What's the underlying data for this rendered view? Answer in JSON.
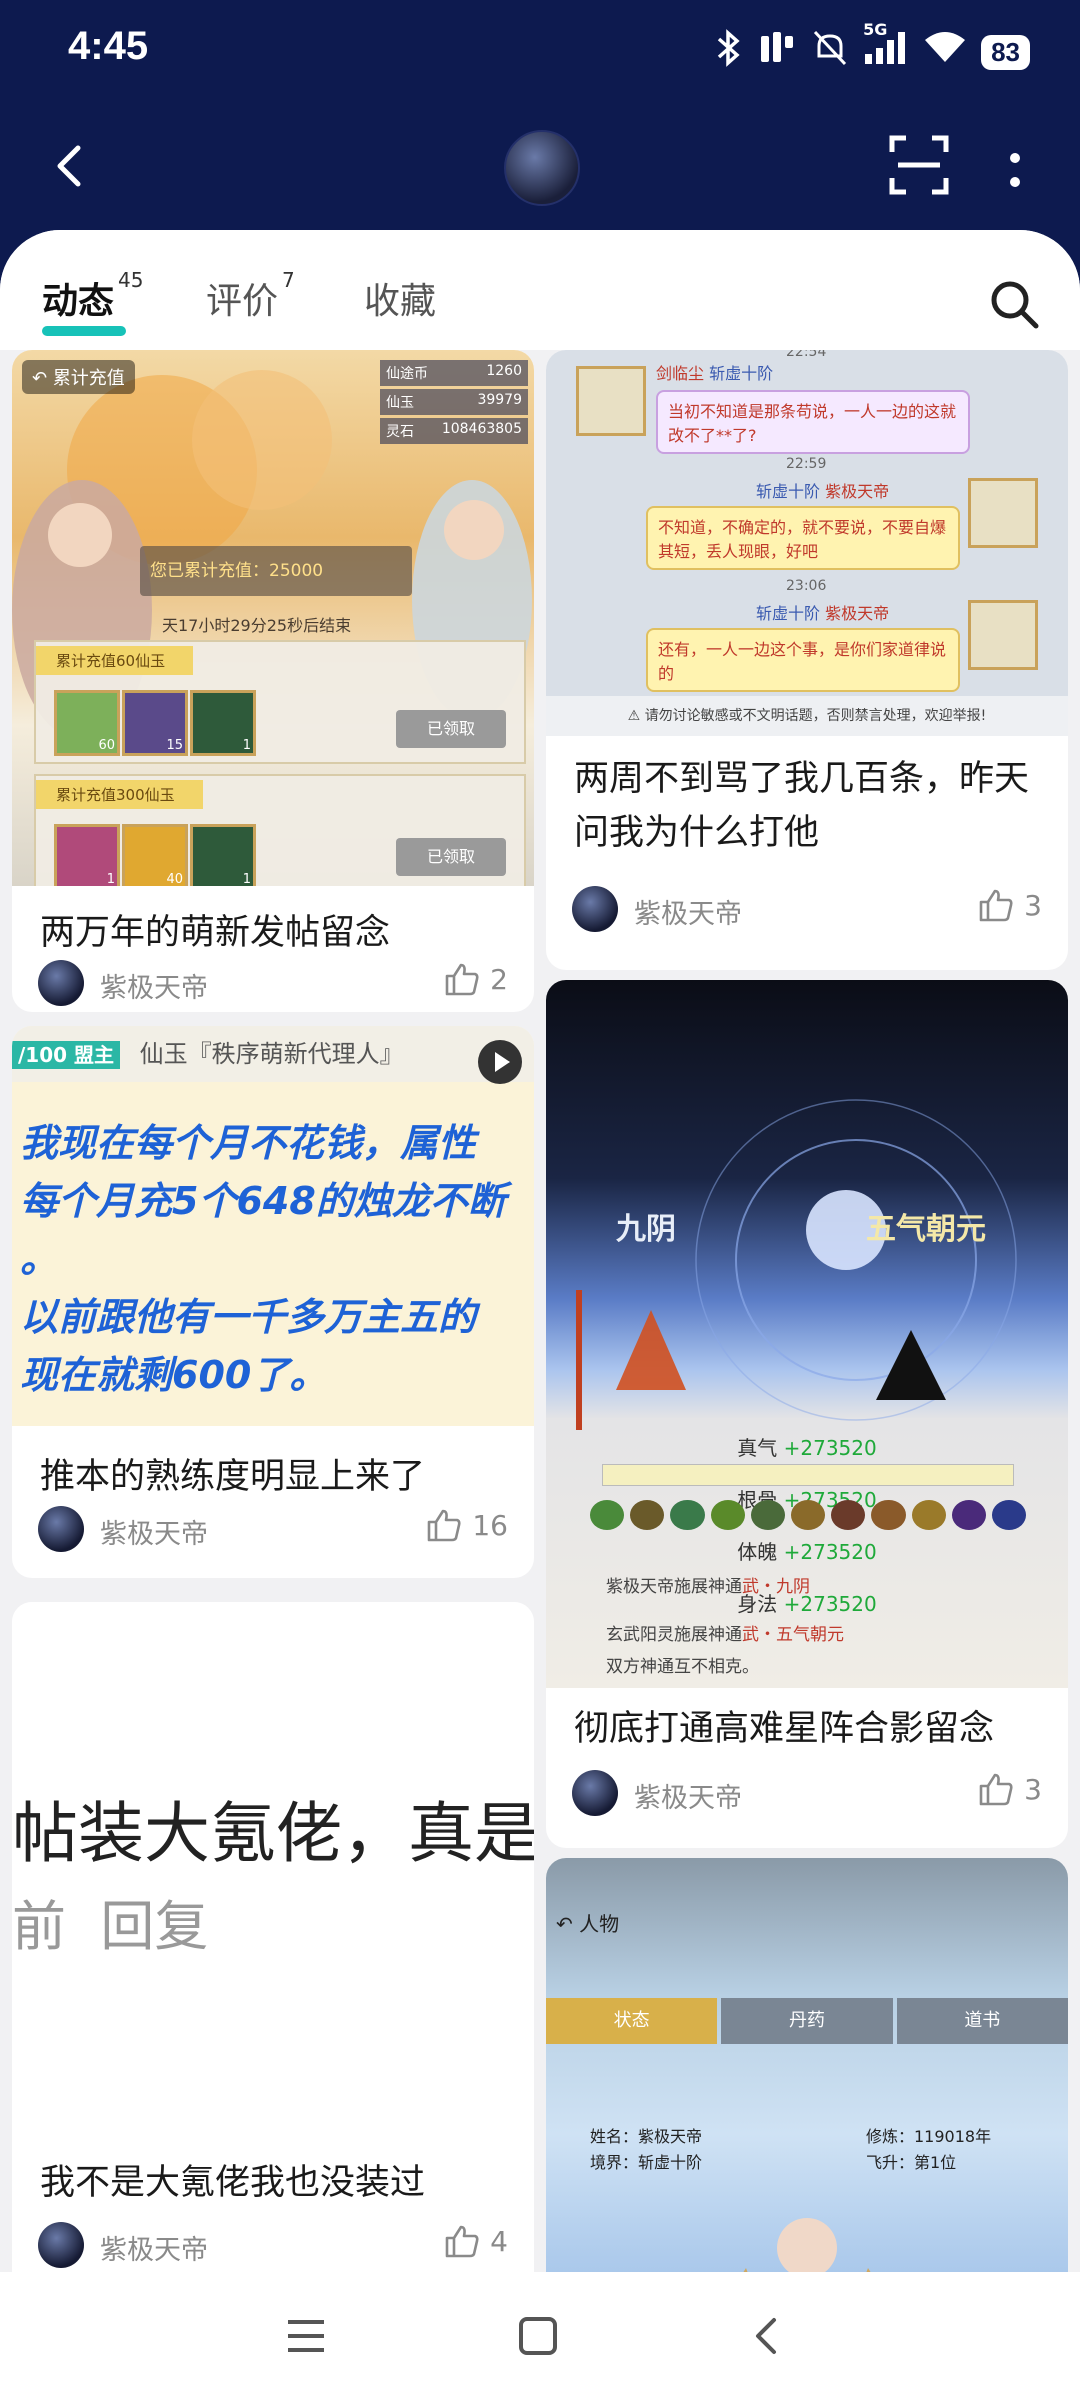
{
  "status": {
    "time": "4:45",
    "network": "5G",
    "battery": "83"
  },
  "tabs": [
    {
      "label": "动态",
      "count": "45"
    },
    {
      "label": "评价",
      "count": "7"
    },
    {
      "label": "收藏"
    }
  ],
  "cards": [
    {
      "title": "两万年的萌新发帖留念",
      "author": "紫极天帝",
      "likes": "2",
      "image": {
        "back": "累计充值",
        "res1_name": "仙途币",
        "res1_val": "1260",
        "res2_name": "仙玉",
        "res2_val": "39979",
        "res3_name": "灵石",
        "res3_val": "108463805",
        "total": "您已累计充值：25000",
        "timer": "天17小时29分25秒后结束",
        "tier1": "累计充值60仙玉",
        "tier2": "累计充值300仙玉",
        "claimed": "已领取",
        "c1": "60",
        "c2": "15",
        "c3": "1",
        "c4": "1",
        "c5": "40",
        "c6": "1"
      }
    },
    {
      "title": "推本的熟练度明显上来了",
      "author": "紫极天帝",
      "likes": "16",
      "image": {
        "prefix": "/100 盟主",
        "header": "仙玉『秩序萌新代理人』",
        "line1": "我现在每个月不花钱，属性",
        "line2": "每个月充5个648的烛龙不断",
        "line3": "。",
        "line4": "以前跟他有一千多万主五的",
        "line5": "现在就剩600了。"
      }
    },
    {
      "title": "我不是大氪佬我也没装过",
      "author": "紫极天帝",
      "likes": "4",
      "image": {
        "line1": "帖装大氪佬，真是",
        "line2": "前  回复"
      }
    },
    {
      "title": "两周不到骂了我几百条，昨天问我为什么打他",
      "author": "紫极天帝",
      "likes": "3",
      "image": {
        "t1": "22:54",
        "name1": "剑临尘",
        "rank1": "斩虚十阶",
        "msg1": "当初不知道是那条苟说，一人一边的这就改不了**了?",
        "t2": "22:59",
        "name2": "紫极天帝",
        "rank2": "斩虚十阶",
        "msg2": "不知道，不确定的，就不要说，不要自爆其短，丢人现眼，好吧",
        "t3": "23:06",
        "msg3": "还有，一人一边这个事，是你们家道律说的",
        "warning": "请勿讨论敏感或不文明话题，否则禁言处理，欢迎举报!"
      }
    },
    {
      "title": "彻底打通高难星阵合影留念",
      "author": "紫极天帝",
      "likes": "3",
      "image": {
        "left": "九阴",
        "right": "五气朝元",
        "s1": "真气",
        "v1": "+273520",
        "s2": "根骨",
        "v2": "+273520",
        "s3": "体魄",
        "v3": "+273520",
        "s4": "身法",
        "v4": "+273520",
        "l1a": "紫极天帝施展神通",
        "l1b": "武・九阴",
        "l2a": "玄武阳灵施展神通",
        "l2b": "武・五气朝元",
        "l3": "双方神通互不相克。"
      }
    },
    {
      "title": "",
      "author": "",
      "likes": "",
      "image": {
        "back": "人物",
        "tab1": "状态",
        "tab2": "丹药",
        "tab3": "道书",
        "name_label": "姓名：紫极天帝",
        "realm_label": "境界：斩虚十阶",
        "power_label": "修炼：119018年",
        "rank_label": "飞升：第1位"
      }
    }
  ]
}
